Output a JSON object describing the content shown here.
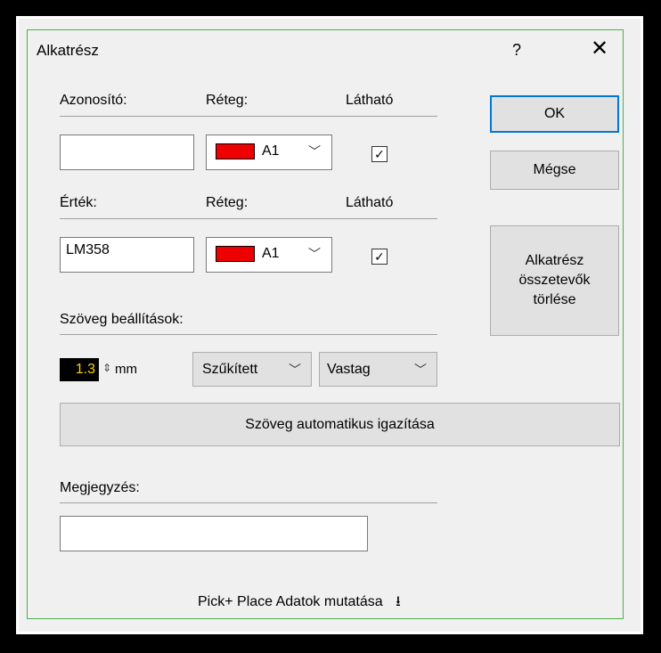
{
  "dialog": {
    "title": "Alkatrész",
    "help_label": "?",
    "close_label": "✕"
  },
  "id_section": {
    "id_header": "Azonosító:",
    "layer_header": "Réteg:",
    "visible_header": "Látható",
    "id_value": "",
    "layer_value": "A1",
    "visible_checked": true
  },
  "value_section": {
    "value_header": "Érték:",
    "layer_header": "Réteg:",
    "visible_header": "Látható",
    "value": "LM358",
    "layer_value": "A1",
    "visible_checked": true
  },
  "text_settings": {
    "header": "Szöveg beállítások:",
    "size_value": "1.3",
    "unit": "mm",
    "width_option": "Szűkített",
    "weight_option": "Vastag",
    "auto_align_label": "Szöveg automatikus igazítása"
  },
  "note": {
    "header": "Megjegyzés:",
    "value": ""
  },
  "buttons": {
    "ok": "OK",
    "cancel": "Mégse",
    "delete_components_line1": "Alkatrész",
    "delete_components_line2": "összetevők",
    "delete_components_line3": "törlése"
  },
  "footer": {
    "pick_place_label": "Pick+ Place Adatok mutatása",
    "arrow": "⭳"
  },
  "colors": {
    "layer_swatch": "#e00000",
    "size_text": "#f8d000",
    "dialog_border": "#4caf50",
    "ok_border": "#0078d7"
  },
  "icons": {
    "help": "question-icon",
    "close": "close-icon",
    "dropdown": "chevron-down-icon",
    "checkbox": "check-icon",
    "spinner": "spinner-icon",
    "expand": "down-arrow-icon"
  }
}
